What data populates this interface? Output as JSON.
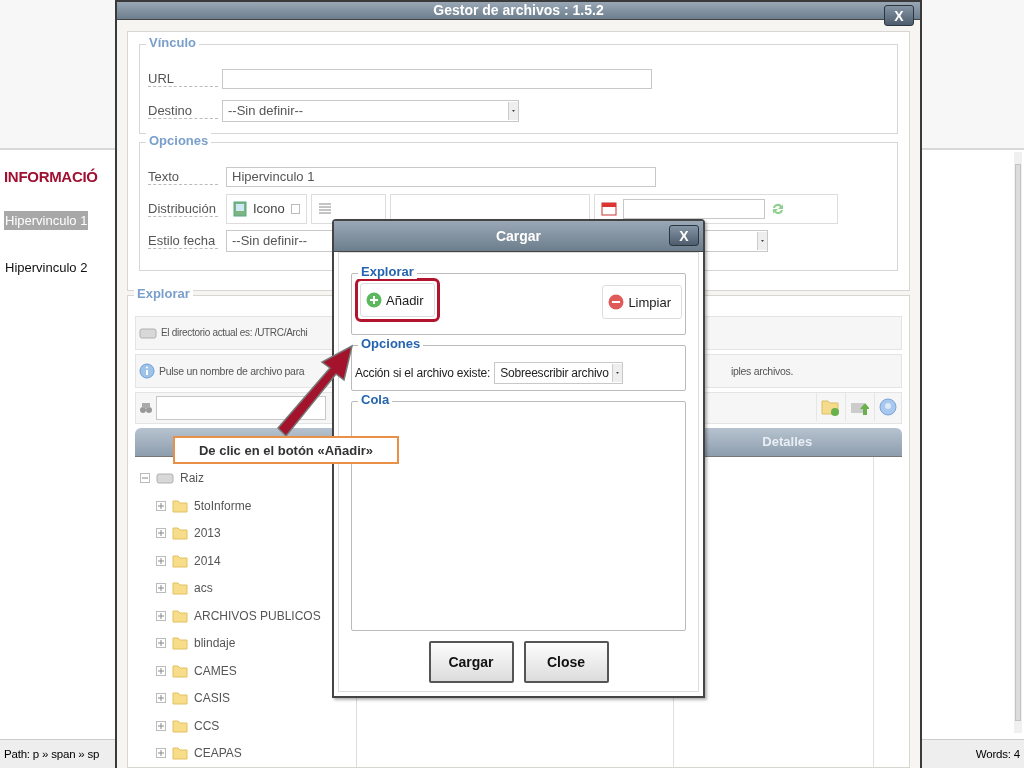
{
  "editor": {
    "heading": "INFORMACIÓ",
    "paragraphs": [
      {
        "text": "Hipervinculo 1",
        "selected": true
      },
      {
        "text": "Hipervinculo 2",
        "selected": false
      }
    ],
    "status_path": "Path: p » span » sp",
    "word_count": "Words: 4"
  },
  "file_manager": {
    "title": "Gestor de archivos : 1.5.2",
    "close": "X",
    "link_section": {
      "legend": "Vínculo",
      "fields": [
        {
          "label": "URL",
          "kind": "text"
        },
        {
          "label": "Destino",
          "kind": "select",
          "value": "--Sin definir--"
        }
      ]
    },
    "options_section": {
      "legend": "Opciones",
      "text_label": "Texto",
      "text_value": "Hipervinculo 1",
      "layout_label": "Distribución",
      "layout_options": [
        {
          "label": "Icono",
          "checked": false
        }
      ],
      "date_label": "Estilo fecha",
      "date_value": "--Sin definir--"
    },
    "explore_section": {
      "legend": "Explorar",
      "current_dir": "El directorio actual es: /UTRC/Archi",
      "hint_start": "Pulse un nombre de archivo para",
      "hint_end": "iples archivos.",
      "details_header": "Detalles",
      "tree": [
        {
          "label": "Raiz",
          "expanded": true,
          "children": [
            {
              "label": "5toInforme",
              "expanded": false
            },
            {
              "label": "2013",
              "expanded": false
            },
            {
              "label": "2014",
              "expanded": false
            },
            {
              "label": "acs",
              "expanded": false
            },
            {
              "label": "ARCHIVOS PUBLICOS",
              "expanded": false
            },
            {
              "label": "blindaje",
              "expanded": false
            },
            {
              "label": "CAMES",
              "expanded": false
            },
            {
              "label": "CASIS",
              "expanded": false
            },
            {
              "label": "CCS",
              "expanded": false
            },
            {
              "label": "CEAPAS",
              "expanded": false
            }
          ]
        }
      ]
    }
  },
  "upload_dialog": {
    "title": "Cargar",
    "close": "X",
    "explore_legend": "Explorar",
    "add_button": "Añadir",
    "clear_button": "Limpiar",
    "options_legend": "Opciones",
    "exists_label": "Acción si el archivo existe:",
    "exists_value": "Sobreescribir archivo",
    "queue_legend": "Cola",
    "buttons": [
      "Cargar",
      "Close"
    ]
  },
  "annotation": {
    "callout": "De clic en el botón «Añadir»"
  }
}
